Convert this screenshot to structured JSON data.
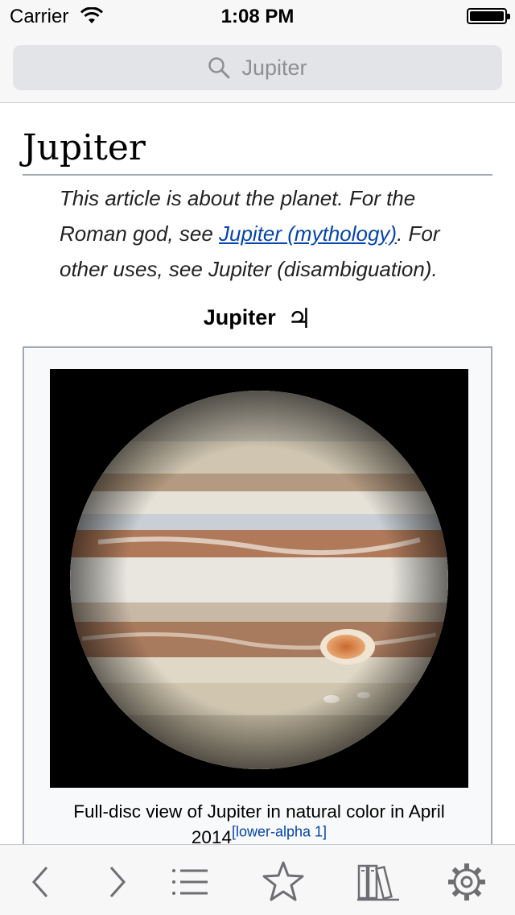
{
  "status_bar": {
    "carrier": "Carrier",
    "time": "1:08 PM",
    "wifi_icon": "wifi-icon",
    "battery_icon": "battery-icon"
  },
  "search": {
    "icon": "search-icon",
    "text": "Jupiter"
  },
  "article": {
    "title": "Jupiter",
    "hatnote": {
      "part1": "This article is about the planet. For the Roman god, see ",
      "link": "Jupiter (mythology)",
      "part2": ". For other uses, see Jupiter (disambiguation)."
    },
    "infobox": {
      "title": "Jupiter",
      "symbol": "♃",
      "image_alt": "Full-disc image of Jupiter",
      "caption": "Full-disc view of Jupiter in natural color in April 2014",
      "caption_ref": "[lower-alpha 1]"
    }
  },
  "toolbar": {
    "items": [
      "back-icon",
      "forward-icon",
      "table-of-contents-icon",
      "save-star-icon",
      "library-icon",
      "settings-gear-icon"
    ]
  },
  "colors": {
    "link": "#0645ad",
    "chrome_bg": "#f7f7f8",
    "icon_gray": "#6d6d72",
    "search_bg": "#e3e4e8"
  }
}
